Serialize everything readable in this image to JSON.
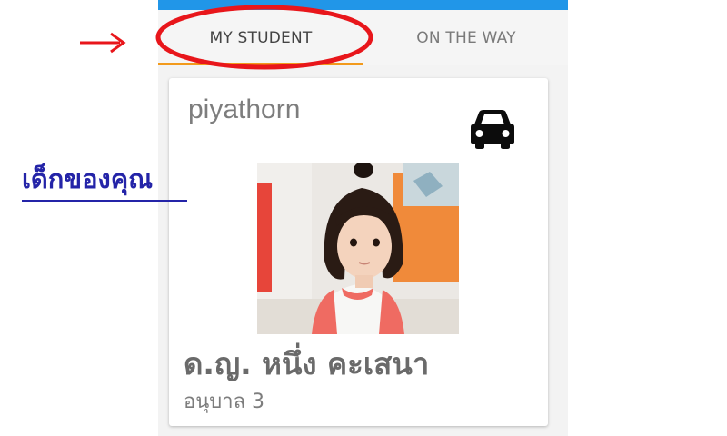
{
  "tabs": {
    "my_student": "MY STUDENT",
    "on_the_way": "ON THE WAY"
  },
  "card": {
    "username": "piyathorn",
    "icon": "car-icon",
    "student_name": "ด.ญ. หนึ่ง คะเสนา",
    "student_class": "อนุบาล 3"
  },
  "annotation": {
    "label": "เด็กของคุณ",
    "highlight_color": "#e8161b",
    "label_color": "#2424a8"
  },
  "colors": {
    "topbar": "#2196e8",
    "tab_indicator": "#f29a1c"
  }
}
